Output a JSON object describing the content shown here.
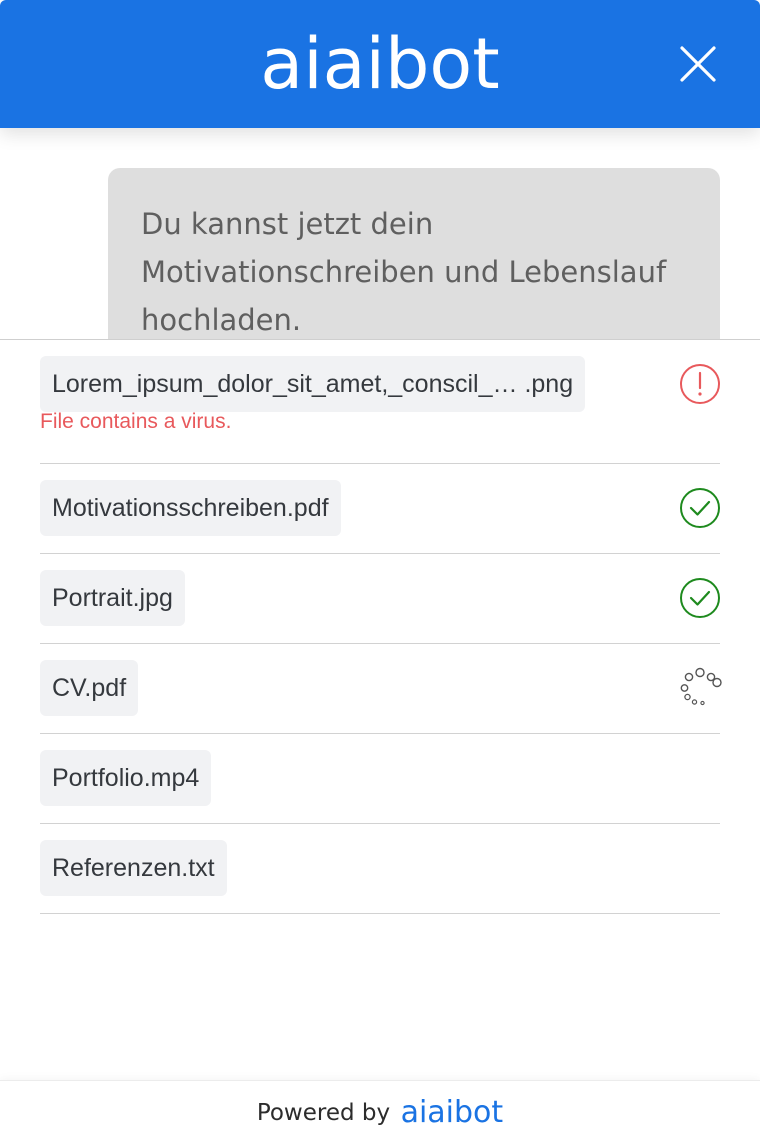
{
  "header": {
    "logo_text": "aiaibot",
    "close_icon": "close-icon",
    "background_color": "#1a73e3"
  },
  "chat": {
    "bot_message": "Du kannst jetzt dein Motivationschreiben und Lebenslauf hochladen."
  },
  "uploads": {
    "files": [
      {
        "name": "Lorem_ipsum_dolor_sit_amet,_conscil_… .png",
        "status": "error",
        "status_icon": "error-icon",
        "error_message": "File contains a virus."
      },
      {
        "name": "Motivationsschreiben.pdf",
        "status": "success",
        "status_icon": "check-circle-icon"
      },
      {
        "name": "Portrait.jpg",
        "status": "success",
        "status_icon": "check-circle-icon"
      },
      {
        "name": "CV.pdf",
        "status": "uploading",
        "status_icon": "spinner-icon"
      },
      {
        "name": "Portfolio.mp4",
        "status": "queued"
      },
      {
        "name": "Referenzen.txt",
        "status": "queued"
      }
    ]
  },
  "footer": {
    "powered_by": "Powered by",
    "logo_text": "aiaibot"
  },
  "colors": {
    "accent": "#1a73e3",
    "error": "#e8595c",
    "success": "#1e8a1e",
    "chip_background": "#f1f2f4",
    "bubble_background": "#dedede"
  }
}
